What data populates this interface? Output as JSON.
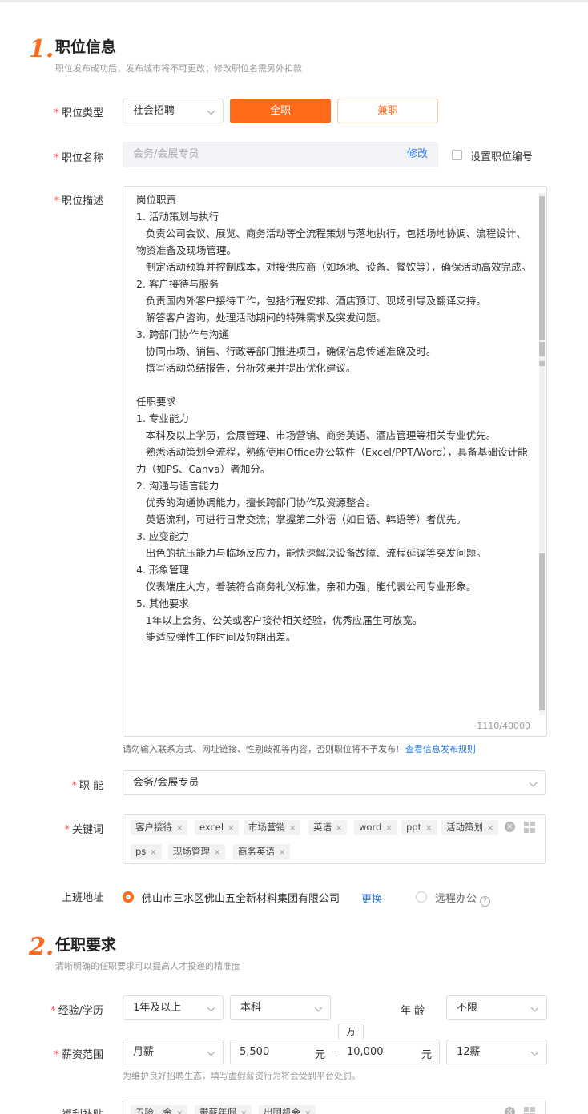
{
  "section1": {
    "number": "1.",
    "title": "职位信息",
    "subtitle": "职位发布成功后，发布城市将不可更改；修改职位名需另外扣款"
  },
  "job_type": {
    "label": "职位类型",
    "select_value": "社会招聘",
    "fulltime_label": "全职",
    "parttime_label": "兼职"
  },
  "job_name": {
    "label": "职位名称",
    "placeholder": "会务/会展专员",
    "edit_link": "修改",
    "checkbox_label": "设置职位编号"
  },
  "job_desc": {
    "label": "职位描述",
    "text": "岗位职责\n1. 活动策划与执行\n   负责公司会议、展览、商务活动等全流程策划与落地执行，包括场地协调、流程设计、物资准备及现场管理。\n   制定活动预算并控制成本，对接供应商（如场地、设备、餐饮等），确保活动高效完成。\n2. 客户接待与服务\n   负责国内外客户接待工作，包括行程安排、酒店预订、现场引导及翻译支持。\n   解答客户咨询，处理活动期间的特殊需求及突发问题。\n3. 跨部门协作与沟通\n   协同市场、销售、行政等部门推进项目，确保信息传递准确及时。\n   撰写活动总结报告，分析效果并提出优化建议。\n\n任职要求\n1. 专业能力\n   本科及以上学历，会展管理、市场营销、商务英语、酒店管理等相关专业优先。\n   熟悉活动策划全流程，熟练使用Office办公软件（Excel/PPT/Word），具备基础设计能力（如PS、Canva）者加分。\n2. 沟通与语言能力\n   优秀的沟通协调能力，擅长跨部门协作及资源整合。\n   英语流利，可进行日常交流；掌握第二外语（如日语、韩语等）者优先。\n3. 应变能力\n   出色的抗压能力与临场反应力，能快速解决设备故障、流程延误等突发问题。\n4. 形象管理\n   仪表端庄大方，着装符合商务礼仪标准，亲和力强，能代表公司专业形象。\n5. 其他要求\n   1年以上会务、公关或客户接待相关经验，优秀应届生可放宽。\n   能适应弹性工作时间及短期出差。",
    "counter": "1110/40000",
    "notice": "请勿输入联系方式、网址链接、性别歧视等内容，否则职位将不予发布!",
    "notice_link": "查看信息发布规则"
  },
  "function": {
    "label": "职 能",
    "value": "会务/会展专员"
  },
  "keywords": {
    "label": "关键词",
    "tags": [
      "客户接待",
      "excel",
      "市场营销",
      "英语",
      "word",
      "ppt",
      "活动策划",
      "ps",
      "现场管理",
      "商务英语"
    ]
  },
  "address": {
    "label": "上班地址",
    "value": "佛山市三水区佛山五全新材料集团有限公司",
    "change_link": "更换",
    "remote_label": "远程办公"
  },
  "section2": {
    "number": "2.",
    "title": "任职要求",
    "subtitle": "清晰明确的任职要求可以提高人才投递的精准度"
  },
  "experience": {
    "label": "经验/学历",
    "experience_value": "1年及以上",
    "education_value": "本科",
    "age_label": "年 龄",
    "age_value": "不限"
  },
  "salary": {
    "label": "薪资范围",
    "type_value": "月薪",
    "min": "5,500",
    "max": "10,000",
    "unit": "元",
    "dash": "-",
    "tooltip": "万",
    "months_value": "12薪",
    "notice": "为维护良好招聘生态，填写虚假薪资行为将会受到平台处罚。"
  },
  "benefits": {
    "label": "福利补贴",
    "tags": [
      "五险一金",
      "带薪年假",
      "出国机会"
    ]
  },
  "colors": {
    "accent": "#ff6a1a",
    "link": "#2c7be5",
    "required": "#ff4d4f"
  }
}
